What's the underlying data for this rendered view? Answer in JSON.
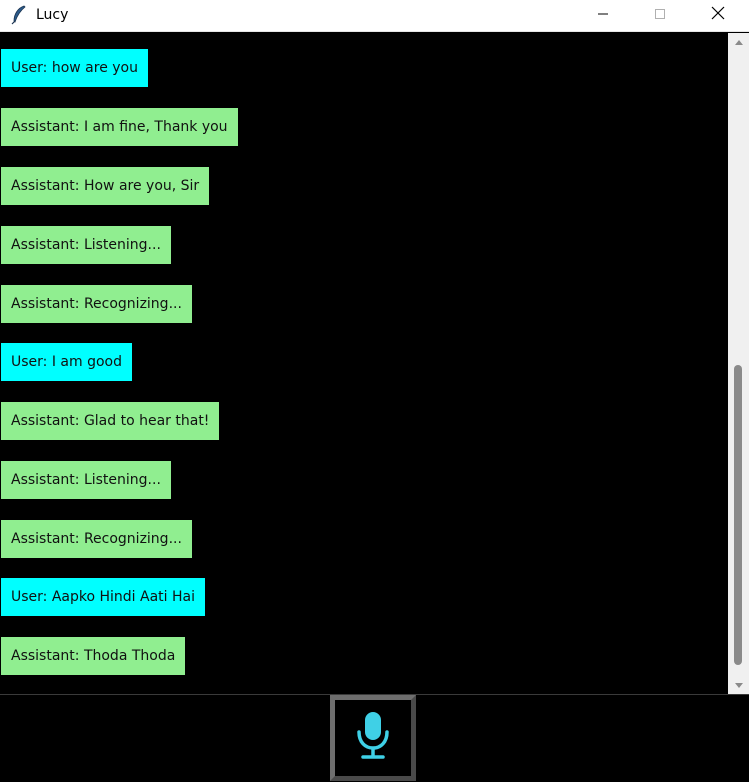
{
  "window": {
    "title": "Lucy",
    "icon": "feather-icon",
    "controls": [
      "minimize-icon",
      "maximize-icon",
      "close-icon"
    ]
  },
  "chat": {
    "messages": [
      {
        "role": "user",
        "text": "User: how are you"
      },
      {
        "role": "assistant",
        "text": "Assistant: I am fine, Thank you"
      },
      {
        "role": "assistant",
        "text": "Assistant: How are you, Sir"
      },
      {
        "role": "assistant",
        "text": "Assistant: Listening..."
      },
      {
        "role": "assistant",
        "text": "Assistant: Recognizing..."
      },
      {
        "role": "user",
        "text": "User: I am good"
      },
      {
        "role": "assistant",
        "text": "Assistant: Glad to hear that!"
      },
      {
        "role": "assistant",
        "text": "Assistant: Listening..."
      },
      {
        "role": "assistant",
        "text": "Assistant: Recognizing..."
      },
      {
        "role": "user",
        "text": "User: Aapko Hindi Aati Hai"
      },
      {
        "role": "assistant",
        "text": "Assistant: Thoda Thoda"
      }
    ]
  },
  "colors": {
    "user_bubble": "#00ffff",
    "assistant_bubble": "#90ee90",
    "background": "#000000",
    "mic_icon": "#3fd0e6"
  },
  "scrollbar": {
    "scroll_position_fraction": 0.5
  },
  "mic_button": {
    "icon": "microphone-icon"
  }
}
